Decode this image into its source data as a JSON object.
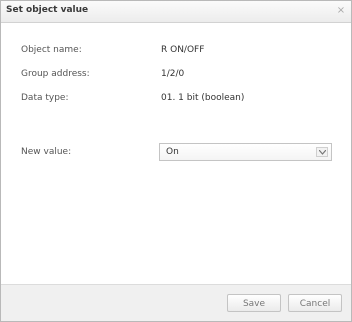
{
  "dialog": {
    "title": "Set object value",
    "close_glyph": "×"
  },
  "fields": [
    {
      "label": "Object name:",
      "value": "R ON/OFF"
    },
    {
      "label": "Group address:",
      "value": "1/2/0"
    },
    {
      "label": "Data type:",
      "value": "01. 1 bit (boolean)"
    }
  ],
  "new_value": {
    "label": "New value:",
    "selected": "On"
  },
  "buttons": {
    "save": "Save",
    "cancel": "Cancel"
  }
}
